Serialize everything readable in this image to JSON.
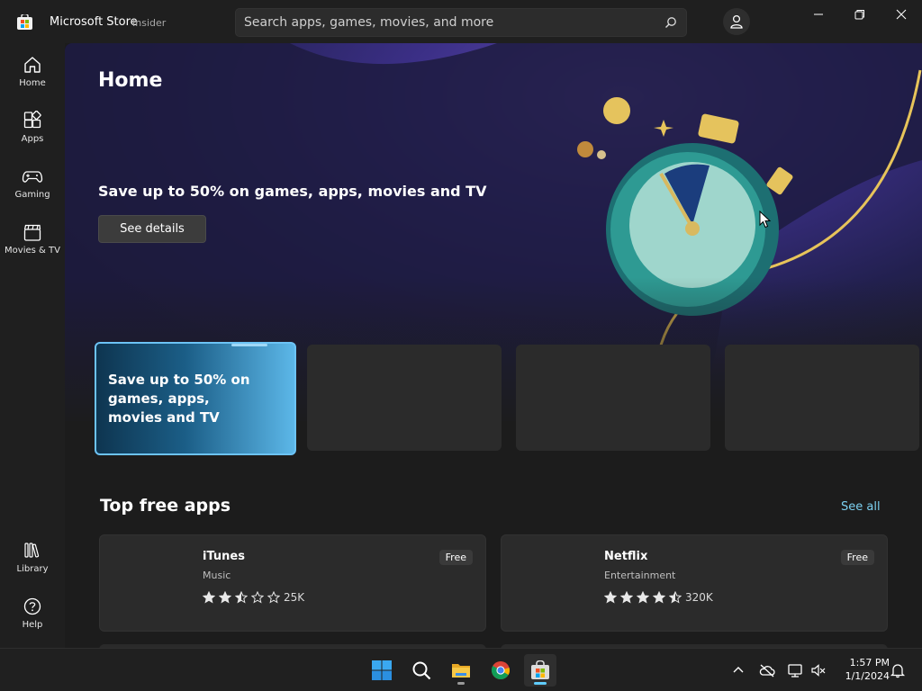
{
  "window": {
    "title": "Microsoft Store",
    "badge": "Insider",
    "search_placeholder": "Search apps, games, movies, and more"
  },
  "sidebar": {
    "items": [
      {
        "label": "Home",
        "icon": "home-icon"
      },
      {
        "label": "Apps",
        "icon": "apps-icon"
      },
      {
        "label": "Gaming",
        "icon": "gamepad-icon"
      },
      {
        "label": "Movies & TV",
        "icon": "clapperboard-icon"
      }
    ],
    "bottom_items": [
      {
        "label": "Library",
        "icon": "library-icon"
      },
      {
        "label": "Help",
        "icon": "help-icon"
      }
    ]
  },
  "hero": {
    "page_title": "Home",
    "promo_title": "Save up to 50% on games, apps, movies and TV",
    "details_button": "See details",
    "active_tile_text": "Save up to 50% on games, apps, movies and TV"
  },
  "top_free": {
    "title": "Top free apps",
    "see_all": "See all",
    "apps": [
      {
        "name": "iTunes",
        "category": "Music",
        "price": "Free",
        "rating": 2.5,
        "count": "25K"
      },
      {
        "name": "Netflix",
        "category": "Entertainment",
        "price": "Free",
        "rating": 4.5,
        "count": "320K"
      }
    ]
  },
  "taskbar": {
    "time": "1:57 PM",
    "date": "1/1/2024"
  },
  "colors": {
    "accent": "#60cdff",
    "link": "#7cd0f0",
    "tile_border": "#6cc3f5"
  }
}
